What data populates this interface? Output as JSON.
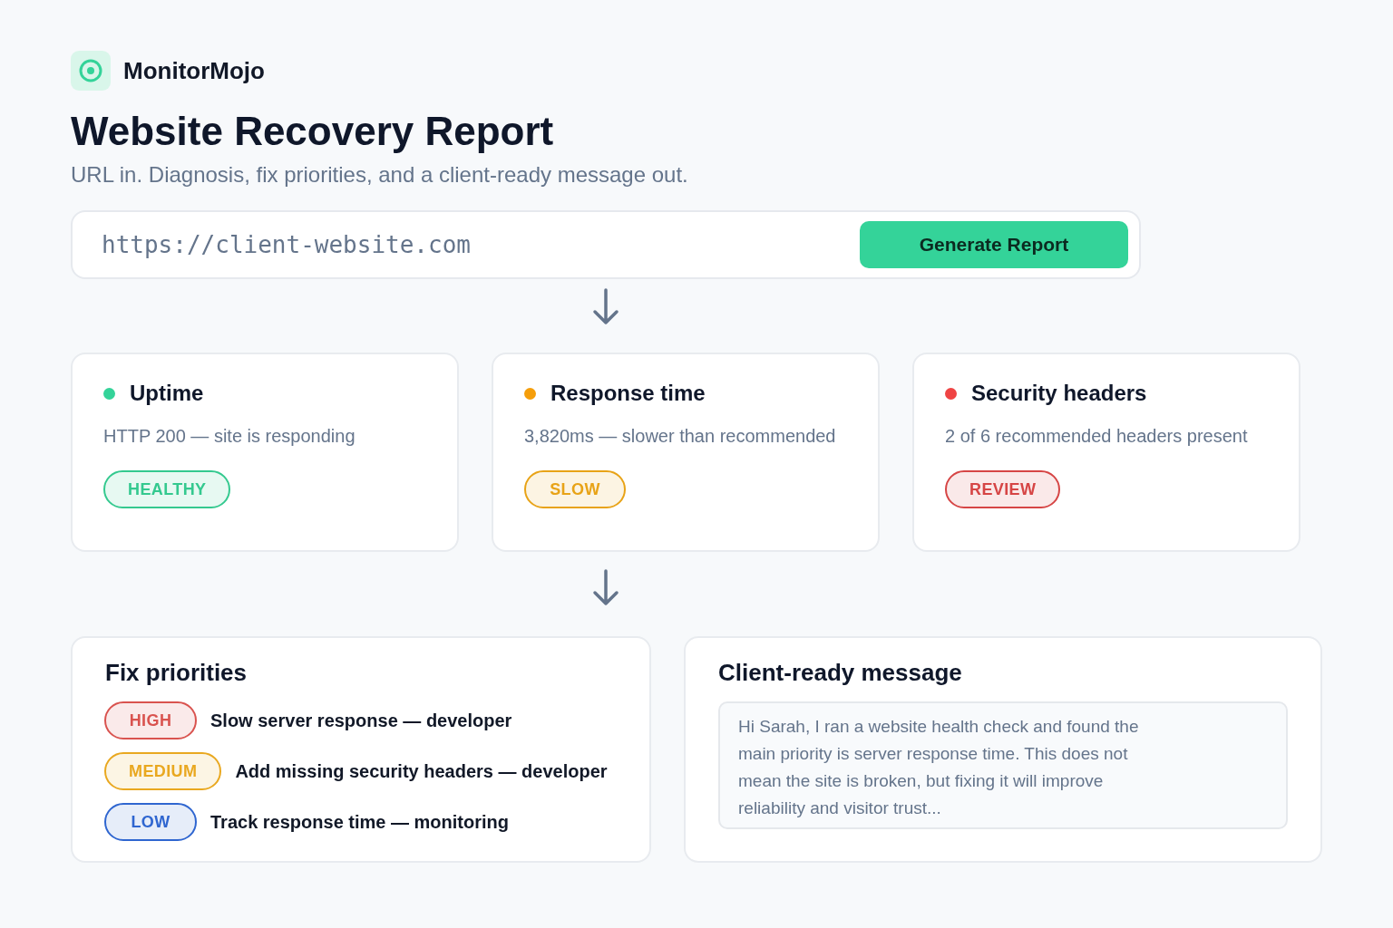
{
  "brand": {
    "name": "MonitorMojo"
  },
  "title": "Website Recovery Report",
  "subtitle": "URL in. Diagnosis, fix priorities, and a client-ready message out.",
  "url_bar": {
    "value": "https://client-website.com",
    "button": "Generate Report"
  },
  "checks": [
    {
      "title": "Uptime",
      "color": "#34d399",
      "description": "HTTP 200 — site is responding",
      "status": {
        "label": "HEALTHY",
        "color": "#34c98f"
      }
    },
    {
      "title": "Response time",
      "color": "#f59e0b",
      "description": "3,820ms — slower than recommended",
      "status": {
        "label": "SLOW",
        "color": "#e8a317"
      }
    },
    {
      "title": "Security headers",
      "color": "#ef4444",
      "description": "2 of 6 recommended headers present",
      "status": {
        "label": "REVIEW",
        "color": "#d64545"
      }
    }
  ],
  "fix_priorities": {
    "title": "Fix priorities",
    "items": [
      {
        "priority": {
          "label": "HIGH",
          "color": "#d9534f"
        },
        "task": "Slow server response — developer"
      },
      {
        "priority": {
          "label": "MEDIUM",
          "color": "#e9a820"
        },
        "task": "Add missing security headers — developer"
      },
      {
        "priority": {
          "label": "LOW",
          "color": "#2f66d0"
        },
        "task": "Track response time — monitoring"
      }
    ]
  },
  "client_message": {
    "title": "Client-ready message",
    "text": "Hi Sarah, I ran a website health check and found the main priority is server response time. This does not mean the site is broken, but fixing it will improve reliability and visitor trust..."
  }
}
